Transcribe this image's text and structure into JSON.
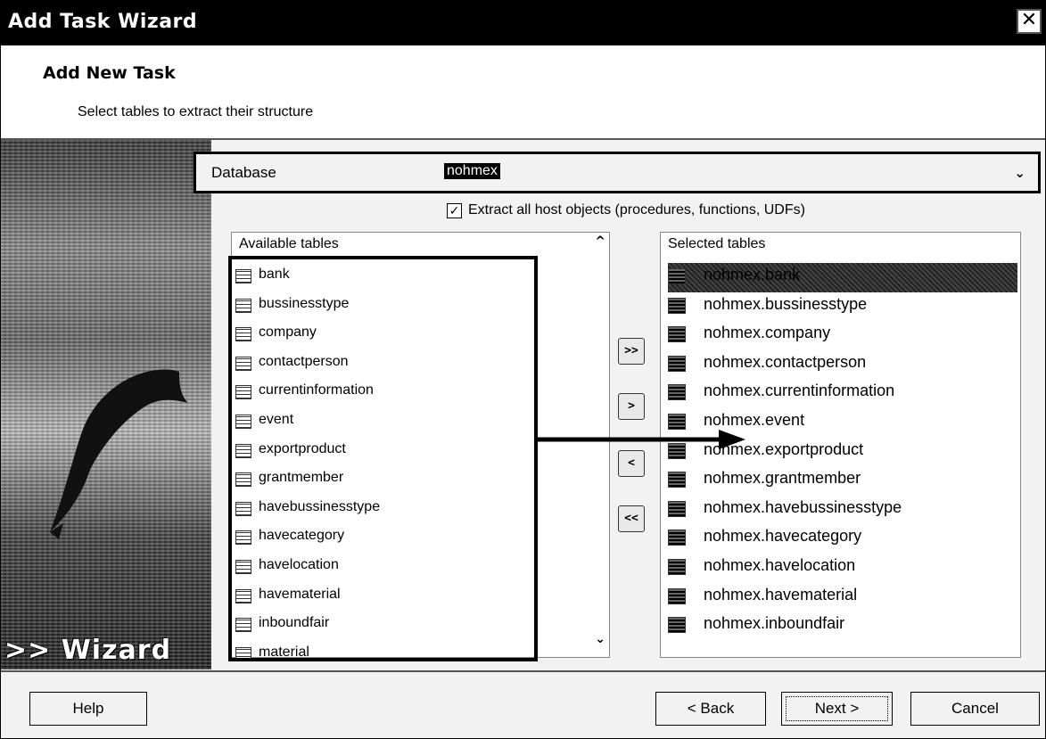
{
  "window": {
    "title": "Add Task Wizard",
    "close_icon": "close-icon"
  },
  "header": {
    "title": "Add New Task",
    "subtitle": "Select tables to extract their structure"
  },
  "sidepanel": {
    "logo_text": ">> Wizard"
  },
  "database": {
    "label": "Database",
    "value": "nohmex"
  },
  "extract": {
    "checked": true,
    "label": "Extract all host objects (procedures, functions, UDFs)"
  },
  "available": {
    "header": "Available tables",
    "items": [
      "bank",
      "bussinesstype",
      "company",
      "contactperson",
      "currentinformation",
      "event",
      "exportproduct",
      "grantmember",
      "havebussinesstype",
      "havecategory",
      "havelocation",
      "havematerial",
      "inboundfair",
      "material"
    ]
  },
  "selected": {
    "header": "Selected tables",
    "items": [
      "nohmex.bank",
      "nohmex.bussinesstype",
      "nohmex.company",
      "nohmex.contactperson",
      "nohmex.currentinformation",
      "nohmex.event",
      "nohmex.exportproduct",
      "nohmex.grantmember",
      "nohmex.havebussinesstype",
      "nohmex.havecategory",
      "nohmex.havelocation",
      "nohmex.havematerial",
      "nohmex.inboundfair"
    ],
    "highlighted_index": 0
  },
  "move_buttons": {
    "add_all": ">>",
    "add": ">",
    "remove": "<",
    "remove_all": "<<"
  },
  "footer": {
    "help": "Help",
    "back": "< Back",
    "next": "Next >",
    "cancel": "Cancel"
  }
}
